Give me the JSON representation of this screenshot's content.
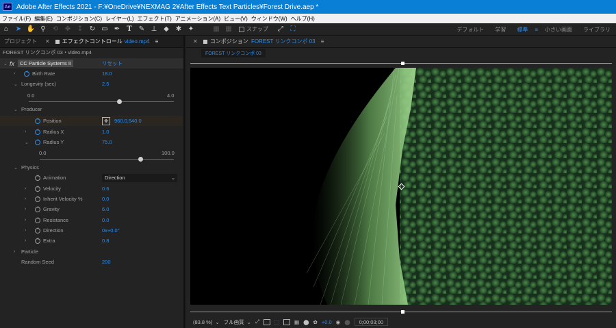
{
  "window": {
    "app_icon": "Ae",
    "title": "Adobe After Effects 2021 - F:¥OneDrive¥NEXMAG 2¥After Effects Text Particles¥Forest Drive.aep *"
  },
  "menu": [
    "ファイル(F)",
    "編集(E)",
    "コンポジション(C)",
    "レイヤー(L)",
    "エフェクト(T)",
    "アニメーション(A)",
    "ビュー(V)",
    "ウィンドウ(W)",
    "ヘルプ(H)"
  ],
  "toolbar": {
    "tools": [
      "home-icon",
      "selection-arrow-icon",
      "hand-icon",
      "zoom-icon",
      "orbit-icon",
      "pan-icon",
      "dolly-icon",
      "rotate-icon",
      "rectangle-icon",
      "pen-icon",
      "type-icon",
      "brush-icon",
      "clone-stamp-icon",
      "eraser-icon",
      "roto-brush-icon",
      "puppet-icon"
    ],
    "snap_label": "スナップ",
    "workspaces": [
      "デフォルト",
      "学習",
      "標準",
      "小さい画面",
      "ライブラリ"
    ],
    "active_workspace": "標準"
  },
  "left_panel": {
    "tabs": {
      "project": "プロジェクト",
      "effect_controls": "エフェクトコントロール",
      "effect_controls_layer": "video.mp4"
    },
    "path": "FOREST リンクコンポ 03・video.mp4",
    "effect": {
      "fx_badge": "fx",
      "name": "CC Particle Systems II",
      "reset": "リセット"
    },
    "props": {
      "birth_rate": {
        "label": "Birth Rate",
        "value": "18.0"
      },
      "longevity": {
        "label": "Longevity (sec)",
        "value": "2.5",
        "min": "0.0",
        "max": "4.0",
        "level": 0.625
      },
      "producer": {
        "label": "Producer"
      },
      "position": {
        "label": "Position",
        "value": "960.0,540.0"
      },
      "radius_x": {
        "label": "Radius X",
        "value": "1.0"
      },
      "radius_y": {
        "label": "Radius Y",
        "value": "75.0",
        "min": "0.0",
        "max": "100.0",
        "level": 0.75
      },
      "physics": {
        "label": "Physics"
      },
      "animation": {
        "label": "Animation",
        "value": "Direction"
      },
      "velocity": {
        "label": "Velocity",
        "value": "0.6"
      },
      "inherit_velocity": {
        "label": "Inherit Velocity %",
        "value": "0.0"
      },
      "gravity": {
        "label": "Gravity",
        "value": "6.0"
      },
      "resistance": {
        "label": "Resistance",
        "value": "0.0"
      },
      "direction": {
        "label": "Direction",
        "value": "0x+0.0°"
      },
      "extra": {
        "label": "Extra",
        "value": "0.8"
      },
      "particle": {
        "label": "Particle"
      },
      "random_seed": {
        "label": "Random Seed",
        "value": "200"
      }
    }
  },
  "comp_panel": {
    "tab_prefix": "コンポジション",
    "tab_name": "FOREST リンクコンポ 03",
    "subtab": "FOREST リンクコンポ 03",
    "footer": {
      "zoom": "(83.8 %)",
      "resolution": "フル画質",
      "exposure": "+0.0",
      "timecode": "0;00;03;00"
    }
  },
  "colors": {
    "accent": "#2d8ceb",
    "titlebar": "#0a7fd6",
    "panel": "#232323",
    "forest_dark": "#1f3f24",
    "forest_light": "#4c8a48",
    "particle": "#9ed48d"
  }
}
